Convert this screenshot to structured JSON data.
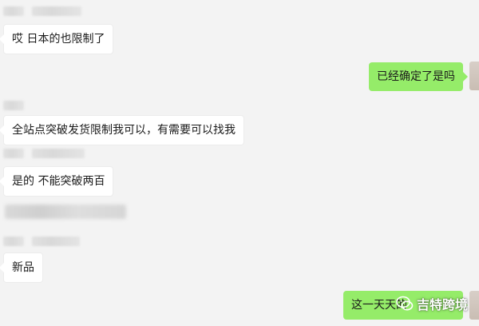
{
  "messages": [
    {
      "text": "哎  日本的也限制了"
    },
    {
      "text": "已经确定了是吗"
    },
    {
      "text": "全站点突破发货限制我可以，有需要可以找我"
    },
    {
      "text": "是的  不能突破两百"
    },
    {
      "text": "新品"
    },
    {
      "text": "这一天天的"
    }
  ],
  "watermark": {
    "text": "吉特跨境",
    "icon": "wechat-icon"
  },
  "colors": {
    "background": "#f3f3f3",
    "incoming_bubble": "#ffffff",
    "outgoing_bubble": "#95ec69"
  }
}
